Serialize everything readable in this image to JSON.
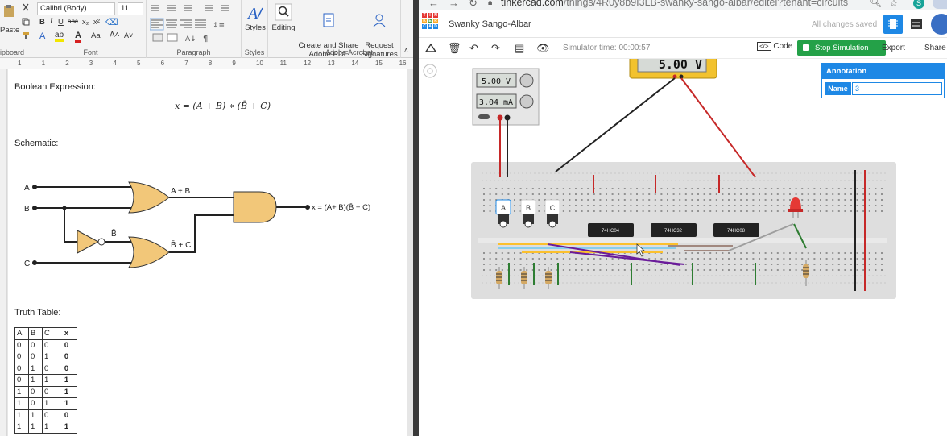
{
  "word": {
    "clipboard": {
      "paste_label": "Paste",
      "group_label": "ipboard"
    },
    "font": {
      "name": "Calibri (Body)",
      "size": "11",
      "group_label": "Font",
      "aa_label": "Aa"
    },
    "paragraph": {
      "group_label": "Paragraph"
    },
    "styles": {
      "label": "Styles",
      "group_label": "Styles"
    },
    "editing": {
      "label": "Editing"
    },
    "acrobat": {
      "create_label": "Create and Share\nAdobe PDF",
      "request_label": "Request\nSignatures",
      "group_label": "Adobe Acrobat"
    },
    "ruler_ticks": [
      "1",
      "1",
      "2",
      "3",
      "4",
      "5",
      "6",
      "7",
      "8",
      "9",
      "10",
      "11",
      "12",
      "13",
      "14",
      "15",
      "16"
    ],
    "document": {
      "boolean_heading": "Boolean Expression:",
      "expression": "x = (A + B) ∗ (B̄ + C)",
      "schematic_heading": "Schematic:",
      "schematic": {
        "input_a": "A",
        "input_b": "B",
        "input_c": "C",
        "or1_label": "A + B",
        "not_label": "B̄",
        "or2_label": "B̄ + C",
        "output_label": "x = (A+ B)(B̄ + C)"
      },
      "truth_heading": "Truth Table:",
      "truth_table": {
        "headers": [
          "A",
          "B",
          "C",
          "x"
        ],
        "rows": [
          [
            "0",
            "0",
            "0",
            "0"
          ],
          [
            "0",
            "0",
            "1",
            "0"
          ],
          [
            "0",
            "1",
            "0",
            "0"
          ],
          [
            "0",
            "1",
            "1",
            "1"
          ],
          [
            "1",
            "0",
            "0",
            "1"
          ],
          [
            "1",
            "0",
            "1",
            "1"
          ],
          [
            "1",
            "1",
            "0",
            "0"
          ],
          [
            "1",
            "1",
            "1",
            "1"
          ]
        ]
      }
    }
  },
  "browser": {
    "url_main": "tinkercad.com",
    "url_path": "/things/4R0y8b9I3LB-swanky-sango-albar/editel?tenant=circuits",
    "profile_initial": "S"
  },
  "tinkercad": {
    "logo_letters": [
      "TIN",
      "KER",
      "CAD"
    ],
    "project_name": "Swanky Sango-Albar",
    "save_status": "All changes saved",
    "sim_time": "Simulator time: 00:00:57",
    "code_label": "Code",
    "stop_label": "Stop Simulation",
    "export_label": "Export",
    "share_label": "Share",
    "multimeter_reading": "5.00 V",
    "supply_voltage": "5.00 V",
    "supply_current": "3.04 mA",
    "switch_labels": [
      "A",
      "B",
      "C"
    ],
    "chip_labels": [
      "74HC04",
      "74HC32",
      "74HC08"
    ],
    "annotation": {
      "title": "Annotation",
      "name_label": "Name",
      "name_value": "3"
    },
    "colors": {
      "accent_blue": "#1e88e5",
      "stop_green": "#24a148",
      "wire_red": "#d32f2f"
    }
  }
}
